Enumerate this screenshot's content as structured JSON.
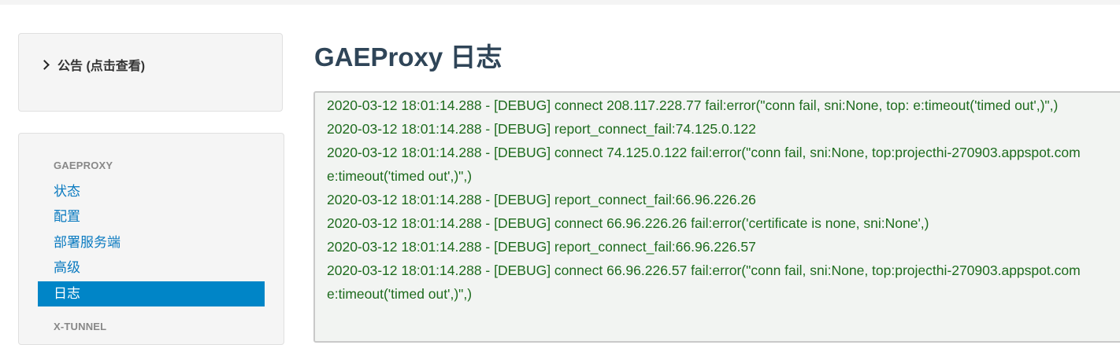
{
  "notice": {
    "label": "公告 (点击查看)"
  },
  "nav": {
    "sections": [
      {
        "header": "GAEPROXY",
        "items": [
          {
            "label": "状态",
            "active": false
          },
          {
            "label": "配置",
            "active": false
          },
          {
            "label": "部署服务端",
            "active": false
          },
          {
            "label": "高级",
            "active": false
          },
          {
            "label": "日志",
            "active": true
          }
        ]
      },
      {
        "header": "X-TUNNEL",
        "items": []
      }
    ]
  },
  "page": {
    "title": "GAEProxy 日志"
  },
  "log": {
    "lines": [
      "2020-03-12 18:01:14.288 - [DEBUG] connect 208.117.228.77 fail:error(\"conn fail, sni:None, top: e:timeout('timed out',)\",)",
      "2020-03-12 18:01:14.288 - [DEBUG] report_connect_fail:74.125.0.122",
      "2020-03-12 18:01:14.288 - [DEBUG] connect 74.125.0.122 fail:error(\"conn fail, sni:None, top:projecthi-270903.appspot.com e:timeout('timed out',)\",)",
      "2020-03-12 18:01:14.288 - [DEBUG] report_connect_fail:66.96.226.26",
      "2020-03-12 18:01:14.288 - [DEBUG] connect 66.96.226.26 fail:error('certificate is none, sni:None',)",
      "2020-03-12 18:01:14.288 - [DEBUG] report_connect_fail:66.96.226.57",
      "2020-03-12 18:01:14.288 - [DEBUG] connect 66.96.226.57 fail:error(\"conn fail, sni:None, top:projecthi-270903.appspot.com e:timeout('timed out',)\",)"
    ]
  },
  "colors": {
    "accent": "#0085c7",
    "link": "#0a7ac0",
    "log_text": "#1e6b1e",
    "title": "#2f4558"
  }
}
